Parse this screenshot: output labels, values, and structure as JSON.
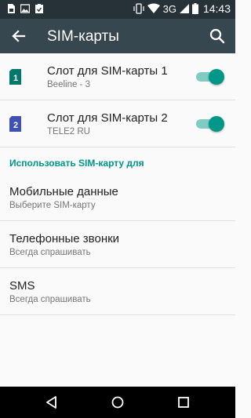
{
  "status_bar": {
    "network": "3G",
    "time": "14:43",
    "left_icons": [
      "sim-card-icon",
      "image-icon",
      "clipboard-check-icon"
    ],
    "right_icons": [
      "vibrate-icon",
      "wifi-icon",
      "signal-icon",
      "battery-icon"
    ]
  },
  "app_bar": {
    "title": "SIM-карты",
    "back_icon": "arrow-back-icon",
    "search_icon": "search-icon"
  },
  "sims": [
    {
      "label": "Слот для SIM-карты 1",
      "operator": "Beeline - 3",
      "badge": "1",
      "badge_color": "#00796b",
      "enabled": true
    },
    {
      "label": "Слот для SIM-карты 2",
      "operator": "TELE2 RU",
      "badge": "2",
      "badge_color": "#3f51b5",
      "enabled": true
    }
  ],
  "section_title": "Использовать SIM-карту для",
  "prefs": [
    {
      "title": "Мобильные данные",
      "summary": "Выберите SIM-карту"
    },
    {
      "title": "Телефонные звонки",
      "summary": "Всегда спрашивать"
    },
    {
      "title": "SMS",
      "summary": "Всегда спрашивать"
    }
  ],
  "nav_bar": {
    "buttons": [
      "back-triangle-icon",
      "home-circle-icon",
      "recents-square-icon"
    ]
  },
  "colors": {
    "accent": "#009688",
    "appbar": "#37474f",
    "statusbar": "#263238"
  }
}
